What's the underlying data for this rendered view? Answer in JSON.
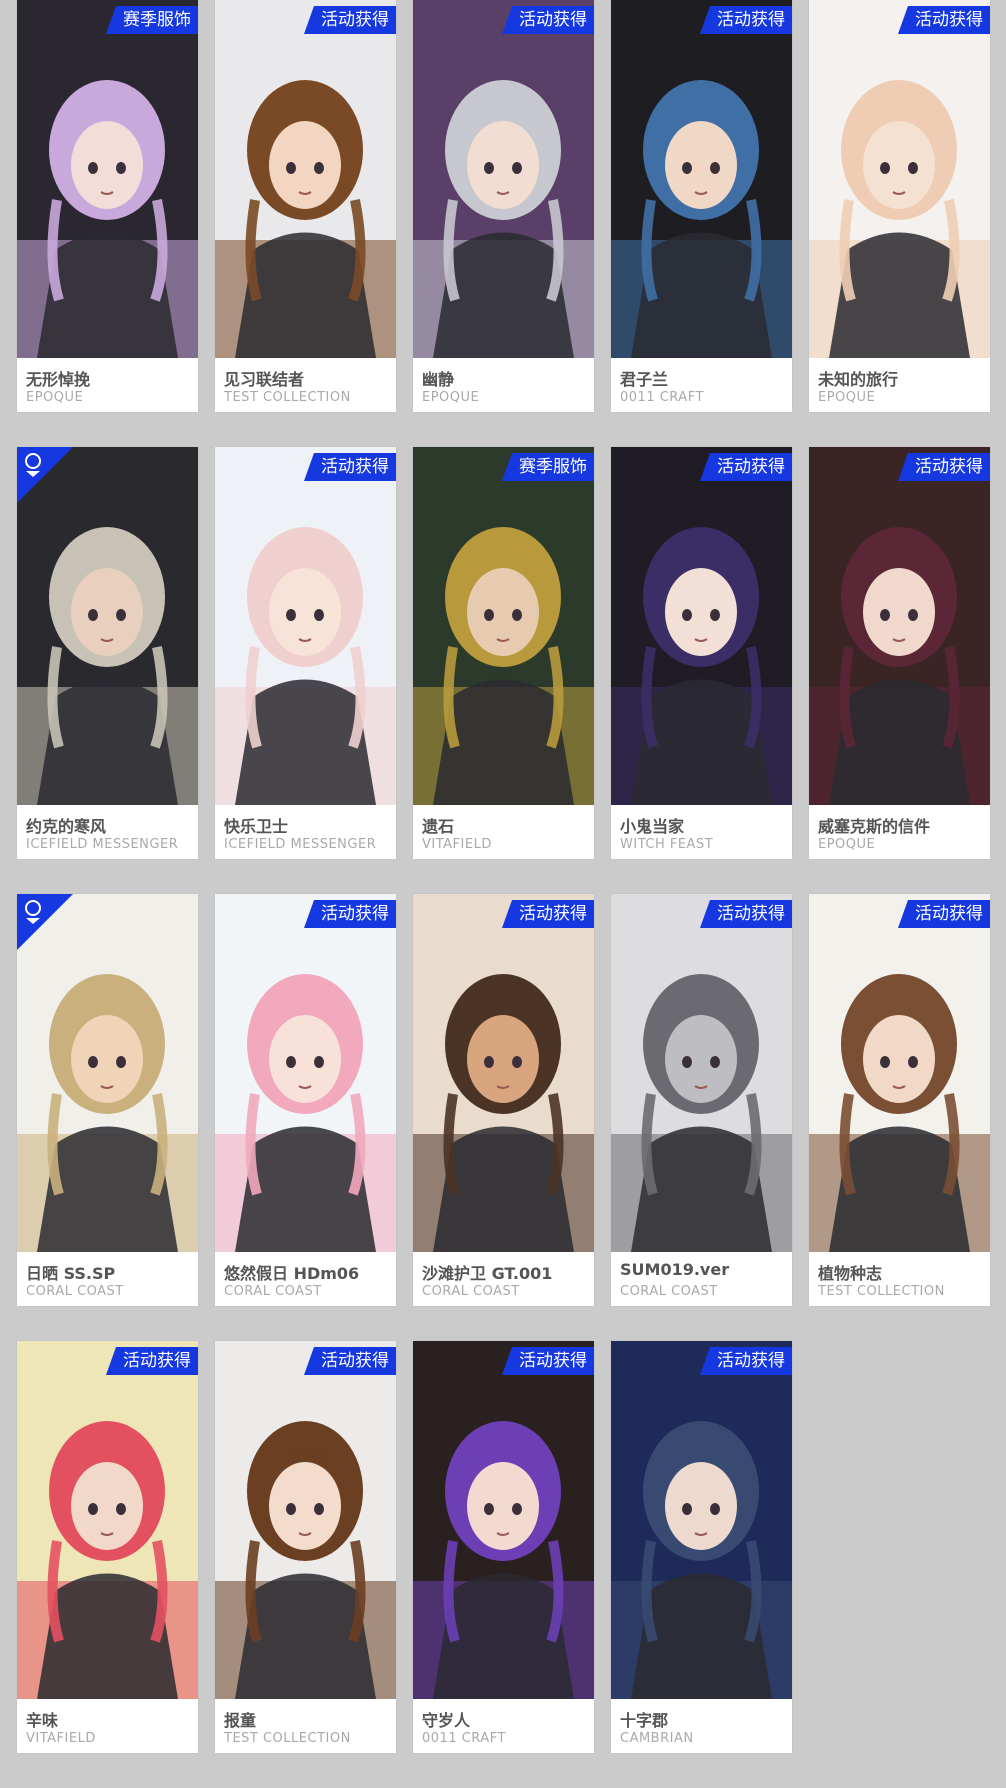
{
  "tag_colors": {
    "badge": "#1638e0",
    "text": "#ffffff"
  },
  "cards": [
    {
      "name": "无形悼挽",
      "brand": "EPOQUE",
      "tag": "赛季服饰",
      "bg": "#2b2730",
      "accent": "#c9a8dc",
      "skin": "#f3ddd9"
    },
    {
      "name": "见习联结者",
      "brand": "TEST COLLECTION",
      "tag": "活动获得",
      "bg": "#e9e9ec",
      "accent": "#7a4a26",
      "skin": "#f2d6c2"
    },
    {
      "name": "幽静",
      "brand": "EPOQUE",
      "tag": "活动获得",
      "bg": "#5a4068",
      "accent": "#c7c7cf",
      "skin": "#f1ddd1"
    },
    {
      "name": "君子兰",
      "brand": "0011 CRAFT",
      "tag": "活动获得",
      "bg": "#1e1e22",
      "accent": "#3f6fa5",
      "skin": "#f1d7c6"
    },
    {
      "name": "未知的旅行",
      "brand": "EPOQUE",
      "tag": "活动获得",
      "bg": "#f4f1ef",
      "accent": "#efcdb4",
      "skin": "#f5e1d2"
    },
    {
      "name": "约克的寒风",
      "brand": "ICEFIELD MESSENGER",
      "tag": "",
      "emblem": true,
      "bg": "#2a2a2e",
      "accent": "#c8c2b6",
      "skin": "#e8cfbe"
    },
    {
      "name": "快乐卫士",
      "brand": "ICEFIELD MESSENGER",
      "tag": "活动获得",
      "bg": "#eef2f6",
      "accent": "#f0cfcf",
      "skin": "#f7e3d8"
    },
    {
      "name": "遗石",
      "brand": "VITAFIELD",
      "tag": "赛季服饰",
      "bg": "#2c3a2c",
      "accent": "#b89a3c",
      "skin": "#e6cbb0"
    },
    {
      "name": "小鬼当家",
      "brand": "WITCH FEAST",
      "tag": "活动获得",
      "bg": "#1f1c26",
      "accent": "#3b2d66",
      "skin": "#f2dfd6"
    },
    {
      "name": "威塞克斯的信件",
      "brand": "EPOQUE",
      "tag": "活动获得",
      "bg": "#3a2424",
      "accent": "#5b2636",
      "skin": "#f0d8cc"
    },
    {
      "name": "日晒 SS.SP",
      "brand": "CORAL COAST",
      "tag": "",
      "emblem": true,
      "bg": "#f1efe9",
      "accent": "#c9b07d",
      "skin": "#f0d4b7"
    },
    {
      "name": "悠然假日 HDm06",
      "brand": "CORAL COAST",
      "tag": "活动获得",
      "bg": "#f2f5f8",
      "accent": "#f2a8bd",
      "skin": "#f7e1d8"
    },
    {
      "name": "沙滩护卫 GT.001",
      "brand": "CORAL COAST",
      "tag": "活动获得",
      "bg": "#e9dccd",
      "accent": "#4b3326",
      "skin": "#d9a57e"
    },
    {
      "name": "SUM019.ver",
      "brand": "CORAL COAST",
      "tag": "活动获得",
      "bg": "#dddde0",
      "accent": "#6a6a70",
      "skin": "#bdbdc2"
    },
    {
      "name": "植物种志",
      "brand": "TEST COLLECTION",
      "tag": "活动获得",
      "bg": "#f3f1ec",
      "accent": "#7a4f34",
      "skin": "#f2d9c7"
    },
    {
      "name": "辛味",
      "brand": "VITAFIELD",
      "tag": "活动获得",
      "bg": "#efe6b8",
      "accent": "#e35161",
      "skin": "#f1d8c9"
    },
    {
      "name": "报童",
      "brand": "TEST COLLECTION",
      "tag": "活动获得",
      "bg": "#ecebea",
      "accent": "#6b3f22",
      "skin": "#f3dccb"
    },
    {
      "name": "守岁人",
      "brand": "0011 CRAFT",
      "tag": "活动获得",
      "bg": "#2a2020",
      "accent": "#6c3fb5",
      "skin": "#f2dad0"
    },
    {
      "name": "十字郡",
      "brand": "CAMBRIAN",
      "tag": "活动获得",
      "bg": "#1d2a5a",
      "accent": "#394a72",
      "skin": "#eed9cf"
    }
  ]
}
